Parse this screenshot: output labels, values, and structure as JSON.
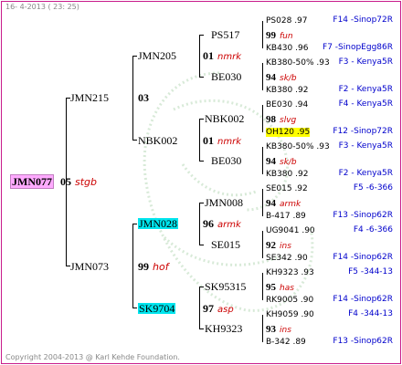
{
  "header": "16- 4-2013 ( 23: 25)",
  "copyright": "Copyright 2004-2013 @ Karl Kehde Foundation.",
  "root": {
    "name": "JMN077",
    "year": "05",
    "code": "stgb"
  },
  "gen1": [
    {
      "name": "JMN215",
      "year": "03",
      "code": ""
    },
    {
      "name": "JMN073",
      "year": "99",
      "code": "hof"
    }
  ],
  "gen2": [
    {
      "name": "JMN205",
      "year": "01",
      "code": "nmrk"
    },
    {
      "name": "NBK002",
      "year": "01",
      "code": "nmrk"
    },
    {
      "name": "JMN028",
      "year": "96",
      "code": "armk"
    },
    {
      "name": "SK9704",
      "year": "97",
      "code": "asp"
    }
  ],
  "gen3": [
    {
      "name": "PS517",
      "year": "99",
      "code": "fun"
    },
    {
      "name": "BE030",
      "year": "94",
      "code": "sk/b"
    },
    {
      "name": "NBK002",
      "year": "98",
      "code": "slvg"
    },
    {
      "name": "BE030",
      "year": "94",
      "code": "sk/b"
    },
    {
      "name": "JMN008",
      "year": "94",
      "code": "armk"
    },
    {
      "name": "SE015",
      "year": "92",
      "code": "ins"
    },
    {
      "name": "SK95315",
      "year": "95",
      "code": "has"
    },
    {
      "name": "KH9323",
      "year": "93",
      "code": "ins"
    }
  ],
  "gen4": [
    {
      "name": "PS028",
      "yr": ".97",
      "src": "F14 -Sinop72R"
    },
    {
      "name": "KB430",
      "yr": ".96",
      "src": "F7 -SinopEgg86R"
    },
    {
      "name": "KB380-50%",
      "yr": ".93",
      "src": "F3 - Kenya5R"
    },
    {
      "name": "KB380",
      "yr": ".92",
      "src": "F2 - Kenya5R"
    },
    {
      "name": "BE030",
      "yr": ".94",
      "src": "F4 - Kenya5R"
    },
    {
      "name": "OH120",
      "yr": ".95",
      "src": "F12 -Sinop72R"
    },
    {
      "name": "KB380-50%",
      "yr": ".93",
      "src": "F3 - Kenya5R"
    },
    {
      "name": "KB380",
      "yr": ".92",
      "src": "F2 - Kenya5R"
    },
    {
      "name": "SE015",
      "yr": ".92",
      "src": "F5 -6-366"
    },
    {
      "name": "B-417",
      "yr": ".89",
      "src": "F13 -Sinop62R"
    },
    {
      "name": "UG9041",
      "yr": ".90",
      "src": "F4 -6-366"
    },
    {
      "name": "SE342",
      "yr": ".90",
      "src": "F14 -Sinop62R"
    },
    {
      "name": "KH9323",
      "yr": ".93",
      "src": "F5 -344-13"
    },
    {
      "name": "RK9005",
      "yr": ".90",
      "src": "F14 -Sinop62R"
    },
    {
      "name": "KH9059",
      "yr": ".90",
      "src": "F4 -344-13"
    },
    {
      "name": "B-342",
      "yr": ".89",
      "src": "F13 -Sinop62R"
    }
  ]
}
